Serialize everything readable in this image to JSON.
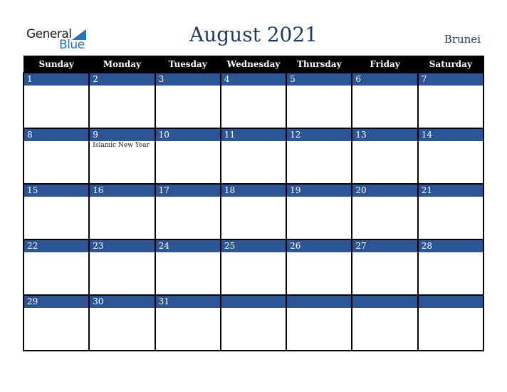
{
  "logo": {
    "line1": "General",
    "line2": "Blue"
  },
  "header": {
    "title": "August 2021",
    "country": "Brunei"
  },
  "colors": {
    "header_bg": "#000000",
    "day_bar": "#2d5494",
    "title": "#203a64",
    "logo_blue": "#2a72b5"
  },
  "weekdays": [
    "Sunday",
    "Monday",
    "Tuesday",
    "Wednesday",
    "Thursday",
    "Friday",
    "Saturday"
  ],
  "weeks": [
    [
      {
        "day": "1",
        "event": ""
      },
      {
        "day": "2",
        "event": ""
      },
      {
        "day": "3",
        "event": ""
      },
      {
        "day": "4",
        "event": ""
      },
      {
        "day": "5",
        "event": ""
      },
      {
        "day": "6",
        "event": ""
      },
      {
        "day": "7",
        "event": ""
      }
    ],
    [
      {
        "day": "8",
        "event": ""
      },
      {
        "day": "9",
        "event": "Islamic New Year"
      },
      {
        "day": "10",
        "event": ""
      },
      {
        "day": "11",
        "event": ""
      },
      {
        "day": "12",
        "event": ""
      },
      {
        "day": "13",
        "event": ""
      },
      {
        "day": "14",
        "event": ""
      }
    ],
    [
      {
        "day": "15",
        "event": ""
      },
      {
        "day": "16",
        "event": ""
      },
      {
        "day": "17",
        "event": ""
      },
      {
        "day": "18",
        "event": ""
      },
      {
        "day": "19",
        "event": ""
      },
      {
        "day": "20",
        "event": ""
      },
      {
        "day": "21",
        "event": ""
      }
    ],
    [
      {
        "day": "22",
        "event": ""
      },
      {
        "day": "23",
        "event": ""
      },
      {
        "day": "24",
        "event": ""
      },
      {
        "day": "25",
        "event": ""
      },
      {
        "day": "26",
        "event": ""
      },
      {
        "day": "27",
        "event": ""
      },
      {
        "day": "28",
        "event": ""
      }
    ],
    [
      {
        "day": "29",
        "event": ""
      },
      {
        "day": "30",
        "event": ""
      },
      {
        "day": "31",
        "event": ""
      },
      {
        "day": "",
        "event": ""
      },
      {
        "day": "",
        "event": ""
      },
      {
        "day": "",
        "event": ""
      },
      {
        "day": "",
        "event": ""
      }
    ]
  ]
}
